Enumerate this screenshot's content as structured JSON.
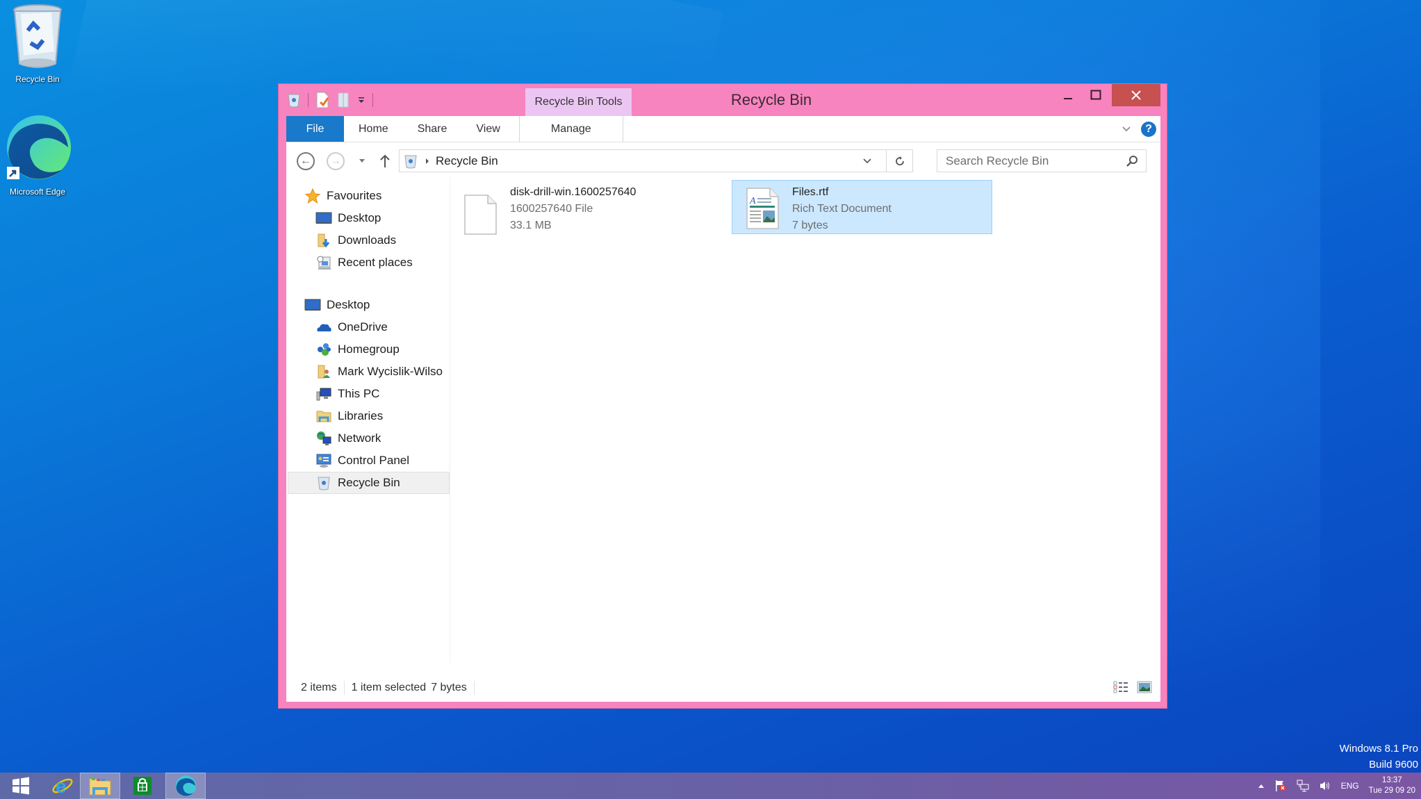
{
  "desktop": {
    "icons": [
      {
        "label": "Recycle Bin",
        "icon": "recycle-bin-full-icon"
      },
      {
        "label": "Microsoft Edge",
        "icon": "edge-icon"
      }
    ],
    "watermark": {
      "line1": "Windows 8.1 Pro",
      "line2": "Build 9600"
    }
  },
  "window": {
    "title": "Recycle Bin",
    "frame_color": "#f783bf",
    "context_tab": "Recycle Bin Tools",
    "ribbon_tabs": [
      "File",
      "Home",
      "Share",
      "View",
      "Manage"
    ],
    "address": {
      "location": "Recycle Bin"
    },
    "search": {
      "placeholder": "Search Recycle Bin"
    },
    "sidebar": {
      "favourites": {
        "label": "Favourites",
        "items": [
          {
            "label": "Desktop",
            "icon": "desktop-icon"
          },
          {
            "label": "Downloads",
            "icon": "downloads-icon"
          },
          {
            "label": "Recent places",
            "icon": "recent-places-icon"
          }
        ]
      },
      "desktop": {
        "label": "Desktop",
        "items": [
          {
            "label": "OneDrive",
            "icon": "onedrive-icon"
          },
          {
            "label": "Homegroup",
            "icon": "homegroup-icon"
          },
          {
            "label": "Mark Wycislik-Wilso",
            "icon": "user-folder-icon"
          },
          {
            "label": "This PC",
            "icon": "this-pc-icon"
          },
          {
            "label": "Libraries",
            "icon": "libraries-icon"
          },
          {
            "label": "Network",
            "icon": "network-icon"
          },
          {
            "label": "Control Panel",
            "icon": "control-panel-icon"
          },
          {
            "label": "Recycle Bin",
            "icon": "recycle-bin-icon",
            "selected": true
          }
        ]
      }
    },
    "files": [
      {
        "name": "disk-drill-win.1600257640",
        "type": "1600257640 File",
        "size": "33.1 MB",
        "selected": false
      },
      {
        "name": "Files.rtf",
        "type": "Rich Text Document",
        "size": "7 bytes",
        "selected": true
      }
    ],
    "status": {
      "count": "2 items",
      "selection": "1 item selected",
      "selection_size": "7 bytes"
    }
  },
  "taskbar": {
    "apps": [
      "start",
      "internet-explorer",
      "file-explorer",
      "store",
      "edge"
    ],
    "tray": {
      "language": "ENG",
      "time": "13:37",
      "date": "Tue 29 09 20"
    }
  }
}
